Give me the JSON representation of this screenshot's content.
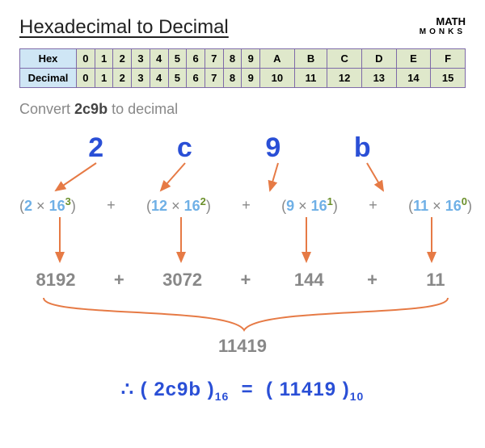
{
  "title": "Hexadecimal to Decimal",
  "brand": {
    "line1": "MATH",
    "line2": "MONKS"
  },
  "table": {
    "row1_label": "Hex",
    "row1_vals": [
      "0",
      "1",
      "2",
      "3",
      "4",
      "5",
      "6",
      "7",
      "8",
      "9",
      "A",
      "B",
      "C",
      "D",
      "E",
      "F"
    ],
    "row2_label": "Decimal",
    "row2_vals": [
      "0",
      "1",
      "2",
      "3",
      "4",
      "5",
      "6",
      "7",
      "8",
      "9",
      "10",
      "11",
      "12",
      "13",
      "14",
      "15"
    ]
  },
  "prompt_prefix": "Convert ",
  "prompt_value": "2c9b",
  "prompt_suffix": " to decimal",
  "digits": [
    "2",
    "c",
    "9",
    "b"
  ],
  "expansion": {
    "terms": [
      {
        "coef": "2",
        "base": "16",
        "exp": "3"
      },
      {
        "coef": "12",
        "base": "16",
        "exp": "2"
      },
      {
        "coef": "9",
        "base": "16",
        "exp": "1"
      },
      {
        "coef": "11",
        "base": "16",
        "exp": "0"
      }
    ]
  },
  "results": [
    "8192",
    "3072",
    "144",
    "11"
  ],
  "sum": "11419",
  "conclusion": {
    "therefore": "∴",
    "lhs": "2c9b",
    "lhs_sub": "16",
    "eq": "=",
    "rhs": "11419",
    "rhs_sub": "10"
  },
  "colors": {
    "arrow": "#e67a45"
  }
}
